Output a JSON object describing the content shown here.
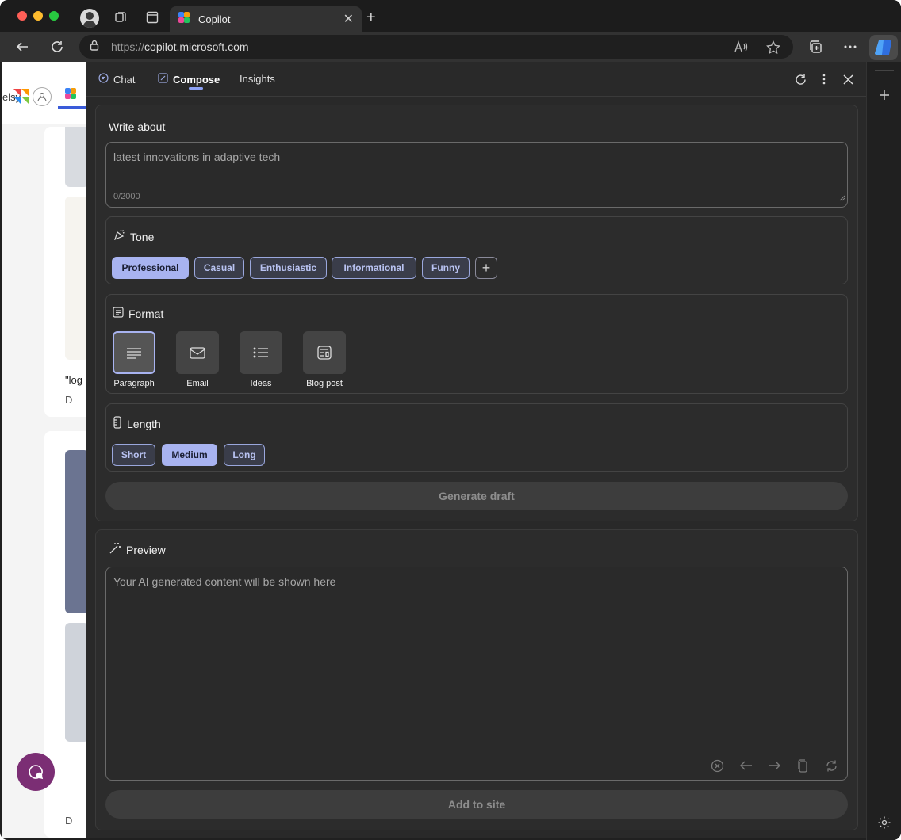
{
  "browser": {
    "tab_title": "Copilot",
    "url_protocol": "https://",
    "url_host": "copilot.microsoft.com"
  },
  "page": {
    "partial_word": "elsy",
    "snippet_1": "\"log",
    "snippet_2": "D",
    "snippet_3": "D"
  },
  "panel": {
    "tabs": [
      {
        "label": "Chat",
        "icon": "chat-icon"
      },
      {
        "label": "Compose",
        "icon": "compose-icon"
      },
      {
        "label": "Insights",
        "icon": ""
      }
    ],
    "active_tab": "Compose"
  },
  "compose": {
    "write_about_title": "Write about",
    "input_value": "latest innovations in adaptive tech",
    "char_count": "0/2000",
    "tone_title": "Tone",
    "tones": [
      "Professional",
      "Casual",
      "Enthusiastic",
      "Informational",
      "Funny"
    ],
    "selected_tone": "Professional",
    "format_title": "Format",
    "formats": [
      "Paragraph",
      "Email",
      "Ideas",
      "Blog post"
    ],
    "selected_format": "Paragraph",
    "length_title": "Length",
    "lengths": [
      "Short",
      "Medium",
      "Long"
    ],
    "selected_length": "Medium",
    "generate_label": "Generate draft"
  },
  "preview": {
    "title": "Preview",
    "placeholder": "Your AI generated content will be shown here",
    "add_label": "Add to site"
  },
  "colors": {
    "accent": "#a8b3f0",
    "panel_bg": "#292929",
    "fab": "#7b2e74"
  }
}
